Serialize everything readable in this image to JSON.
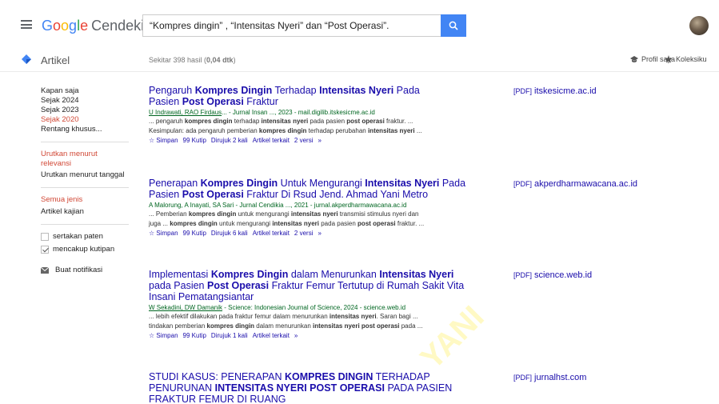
{
  "header": {
    "logo_google": [
      "G",
      "o",
      "o",
      "g",
      "l",
      "e"
    ],
    "logo_sub": "Cendekia",
    "search_value": "“Kompres dingin” , “Intensitas Nyeri” dan “Post Operasi”.",
    "avatar": "user-avatar"
  },
  "subheader": {
    "articles_label": "Artikel",
    "result_count": "Sekitar 398 hasil (0,04 dtk)",
    "profile_label": "Profil saya",
    "library_label": "Koleksiku"
  },
  "sidebar": {
    "time_filters": [
      {
        "label": "Kapan saja",
        "active": false
      },
      {
        "label": "Sejak 2024",
        "active": false
      },
      {
        "label": "Sejak 2023",
        "active": false
      },
      {
        "label": "Sejak 2020",
        "active": true
      },
      {
        "label": "Rentang khusus...",
        "active": false
      }
    ],
    "sort_filters": [
      {
        "label": "Urutkan menurut relevansi",
        "active": true
      },
      {
        "label": "Urutkan menurut tanggal",
        "active": false
      }
    ],
    "type_filters": [
      {
        "label": "Semua jenis",
        "active": true
      },
      {
        "label": "Artikel kajian",
        "active": false
      }
    ],
    "checkboxes": [
      {
        "label": "sertakan paten",
        "checked": false
      },
      {
        "label": "mencakup kutipan",
        "checked": true
      }
    ],
    "alert_label": "Buat notifikasi"
  },
  "results": [
    {
      "title_parts": [
        "Pengaruh ",
        "Kompres Dingin",
        " Terhadap ",
        "Intensitas Nyeri",
        " Pada Pasien ",
        "Post Operasi",
        " Fraktur"
      ],
      "authors": "U Indrawati, RAO Firdaus",
      "meta_rest": "... - Jurnal Insan ..., 2023 - mail.digilib.itskesicme.ac.id",
      "snippet1": "... pengaruh kompres dingin terhadap intensitas nyeri pada pasien post operasi fraktur. ...",
      "snippet2": "Kesimpulan: ada pengaruh pemberian kompres dingin terhadap perubahan intensitas nyeri ...",
      "actions": [
        "Simpan",
        "Kutip",
        "Dirujuk 2 kali",
        "Artikel terkait",
        "2 versi"
      ],
      "pdf_tag": "[PDF]",
      "pdf_source": "itskesicme.ac.id"
    },
    {
      "title_parts": [
        "Penerapan ",
        "Kompres Dingin",
        " Untuk Mengurangi ",
        "Intensitas Nyeri",
        " Pada Pasien ",
        "Post Operasi",
        " Fraktur Di Rsud Jend. Ahmad Yani Metro"
      ],
      "authors": "A Malorung, A Inayati, SA Sari",
      "meta_rest": " - Jurnal Cendikia ..., 2021 - jurnal.akperdharmawacana.ac.id",
      "snippet1": "... Pemberian kompres dingin untuk mengurangi intensitas nyeri transmisi stimulus nyeri dan",
      "snippet2": "juga ... kompres dingin untuk mengurangi intensitas nyeri pada pasien post operasi fraktur. ...",
      "actions": [
        "Simpan",
        "Kutip",
        "Dirujuk 6 kali",
        "Artikel terkait",
        "2 versi"
      ],
      "pdf_tag": "[PDF]",
      "pdf_source": "akperdharmawacana.ac.id"
    },
    {
      "title_parts": [
        "Implementasi ",
        "Kompres Dingin",
        " dalam Menurunkan ",
        "Intensitas Nyeri",
        " pada Pasien ",
        "Post Operasi",
        " Fraktur Femur Tertutup di Rumah Sakit Vita Insani Pematangsiantar"
      ],
      "authors": "W Sekadini, DW Damanik",
      "meta_rest": " - Science: Indonesian Journal of Science, 2024 - science.web.id",
      "snippet1": "... lebih efektif dilakukan pada fraktur femur dalam menurunkan intensitas nyeri. Saran bagi ...",
      "snippet2": "tindakan pemberian kompres dingin dalam menurunkan intensitas nyeri post operasi pada ...",
      "actions": [
        "Simpan",
        "Kutip",
        "Dirujuk 1 kali",
        "Artikel terkait"
      ],
      "pdf_tag": "[PDF]",
      "pdf_source": "science.web.id"
    },
    {
      "title_parts": [
        "STUDI KASUS: PENERAPAN ",
        "KOMPRES DINGIN",
        " TERHADAP PENURUNAN ",
        "INTENSITAS NYERI POST OPERASI",
        " PADA PASIEN FRAKTUR FEMUR DI RUANG"
      ],
      "pdf_tag": "[PDF]",
      "pdf_source": "jurnalhst.com"
    }
  ],
  "watermark": "YANI",
  "colors": {
    "link": "#1a0dab",
    "meta_green": "#006621",
    "active_red": "#d14836",
    "search_blue": "#4285f4"
  }
}
